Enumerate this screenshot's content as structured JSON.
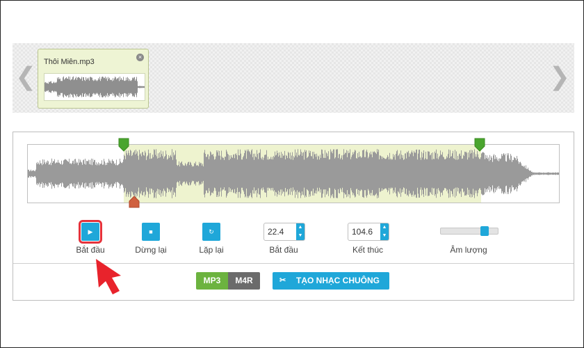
{
  "file_strip": {
    "file_name": "Thôi Miên.mp3",
    "close_icon": "close-circle-icon",
    "prev_icon": "chevron-left-icon",
    "next_icon": "chevron-right-icon"
  },
  "editor": {
    "selection_color": "#eef3cf",
    "marker_color": "#4aa52e",
    "position_marker_color": "#d0603f",
    "controls": {
      "play": {
        "label": "Bắt đầu",
        "icon": "play-icon"
      },
      "stop": {
        "label": "Dừng lại",
        "icon": "stop-icon"
      },
      "loop": {
        "label": "Lặp lại",
        "icon": "loop-icon"
      },
      "start_time": {
        "label": "Bắt đầu",
        "value": "22.4"
      },
      "end_time": {
        "label": "Kết thúc",
        "value": "104.6"
      },
      "volume": {
        "label": "Âm lượng",
        "level": 0.82
      }
    },
    "formats": {
      "mp3": "MP3",
      "m4r": "M4R",
      "selected": "MP3"
    },
    "make_ringtone": {
      "label": "TẠO NHẠC CHUÔNG",
      "icon": "scissors-icon"
    }
  },
  "colors": {
    "accent": "#1fa7d9",
    "mp3_active": "#6cb33f",
    "m4r_inactive": "#6b6b6b",
    "highlight": "#e5323b"
  }
}
